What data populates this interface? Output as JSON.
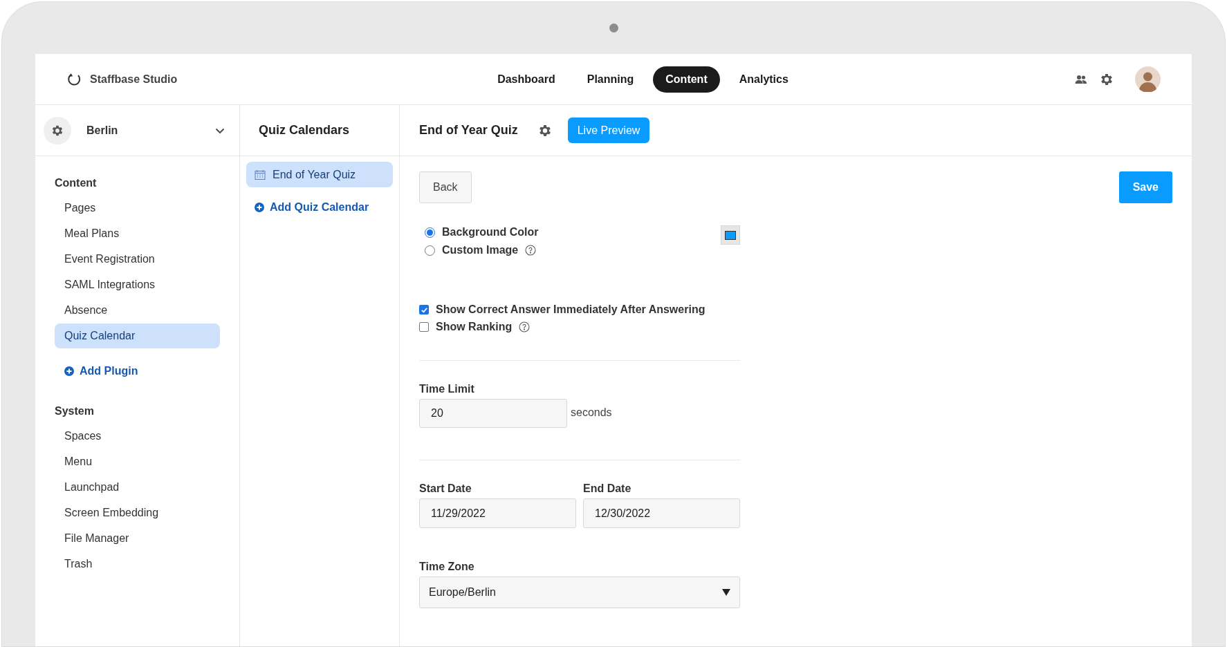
{
  "app": {
    "name": "Staffbase Studio"
  },
  "nav": [
    {
      "label": "Dashboard",
      "selected": false
    },
    {
      "label": "Planning",
      "selected": false
    },
    {
      "label": "Content",
      "selected": true
    },
    {
      "label": "Analytics",
      "selected": false
    }
  ],
  "space": {
    "name": "Berlin"
  },
  "sidebar": {
    "sections": [
      {
        "title": "Content",
        "items": [
          {
            "label": "Pages",
            "selected": false
          },
          {
            "label": "Meal Plans",
            "selected": false
          },
          {
            "label": "Event Registration",
            "selected": false
          },
          {
            "label": "SAML Integrations",
            "selected": false
          },
          {
            "label": "Absence",
            "selected": false
          },
          {
            "label": "Quiz Calendar",
            "selected": true
          }
        ],
        "action": "Add Plugin"
      },
      {
        "title": "System",
        "items": [
          {
            "label": "Spaces",
            "selected": false
          },
          {
            "label": "Menu",
            "selected": false
          },
          {
            "label": "Launchpad",
            "selected": false
          },
          {
            "label": "Screen Embedding",
            "selected": false
          },
          {
            "label": "File Manager",
            "selected": false
          },
          {
            "label": "Trash",
            "selected": false
          }
        ]
      }
    ]
  },
  "calendars": {
    "title": "Quiz Calendars",
    "items": [
      {
        "label": "End of Year Quiz",
        "selected": true
      }
    ],
    "action": "Add Quiz Calendar"
  },
  "editor": {
    "title": "End of Year Quiz",
    "preview_button": "Live Preview",
    "back_button": "Back",
    "save_button": "Save",
    "background": [
      {
        "label": "Background Color",
        "selected": true,
        "help": false
      },
      {
        "label": "Custom Image",
        "selected": false,
        "help": true
      }
    ],
    "options": [
      {
        "label": "Show Correct Answer Immediately After Answering",
        "checked": true,
        "help": false
      },
      {
        "label": "Show Ranking",
        "checked": false,
        "help": true
      }
    ],
    "time_limit": {
      "label": "Time Limit",
      "value": "20",
      "unit": "seconds"
    },
    "dates": [
      {
        "label": "Start Date",
        "value": "11/29/2022"
      },
      {
        "label": "End Date",
        "value": "12/30/2022"
      }
    ],
    "time_zone": {
      "label": "Time Zone",
      "value": "Europe/Berlin"
    }
  }
}
